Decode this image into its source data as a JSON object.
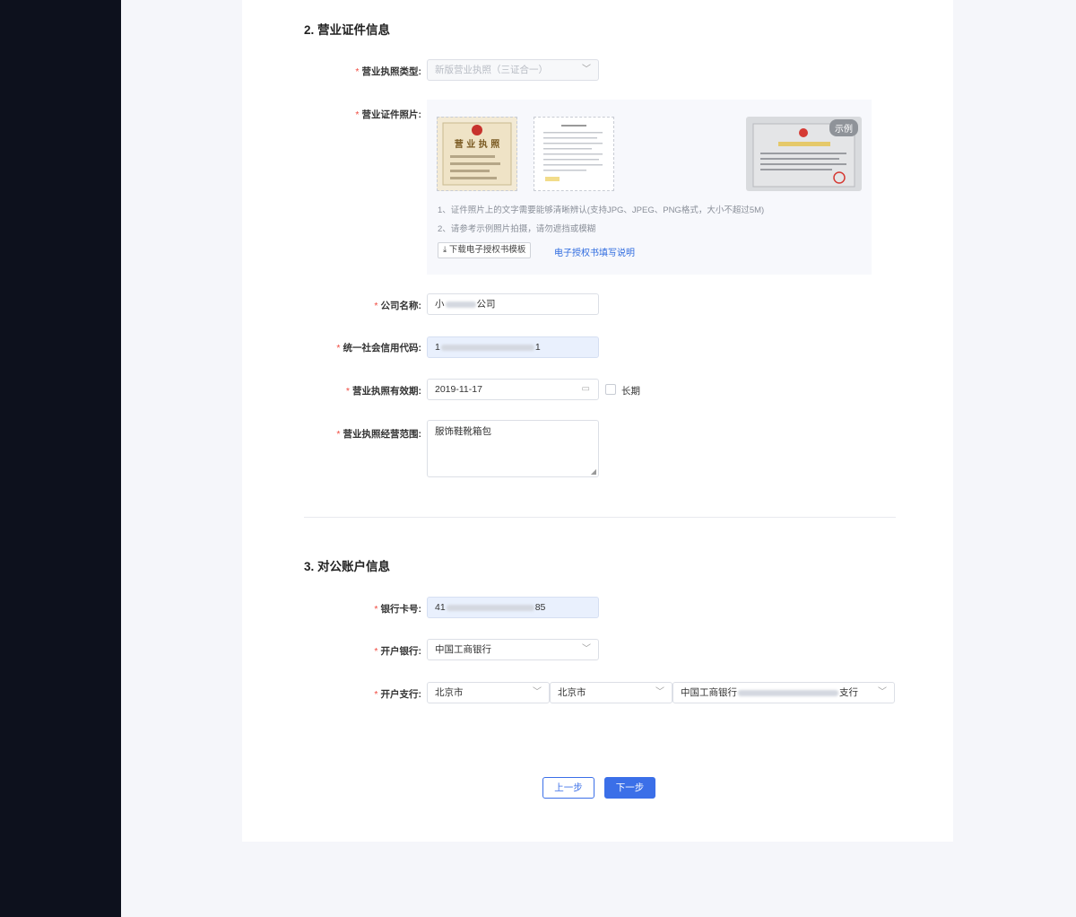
{
  "section2": {
    "title": "2. 营业证件信息",
    "license_type_label": "营业执照类型:",
    "license_type_value": "新版营业执照（三证合一）",
    "license_photo_label": "营业证件照片:",
    "example_badge": "示例",
    "thumb1_text": "营 业 执 照",
    "tip1": "1、证件照片上的文字需要能够清晰辨认(支持JPG、JPEG、PNG格式，大小不超过5M)",
    "tip2": "2、请参考示例照片拍摄，请勿遮挡或模糊",
    "download_button": "下载电子授权书模板",
    "explain_link": "电子授权书填写说明",
    "company_name_label": "公司名称:",
    "company_name_prefix": "小",
    "company_name_suffix": "公司",
    "credit_code_label": "统一社会信用代码:",
    "credit_code_prefix": "1",
    "credit_code_suffix": "1",
    "validity_label": "营业执照有效期:",
    "validity_value": "2019-11-17",
    "long_term_label": "长期",
    "scope_label": "营业执照经营范围:",
    "scope_value": "服饰鞋靴箱包"
  },
  "section3": {
    "title": "3. 对公账户信息",
    "card_label": "银行卡号:",
    "card_prefix": "41",
    "card_suffix": "85",
    "bank_label": "开户银行:",
    "bank_value": "中国工商银行",
    "branch_label": "开户支行:",
    "branch_province": "北京市",
    "branch_city": "北京市",
    "branch_prefix": "中国工商银行",
    "branch_suffix": "支行"
  },
  "buttons": {
    "prev": "上一步",
    "next": "下一步"
  },
  "required_mark": "*",
  "colors": {
    "sidebar": "#0d111d",
    "primary": "#3b6fe8",
    "required": "#f0483e"
  }
}
